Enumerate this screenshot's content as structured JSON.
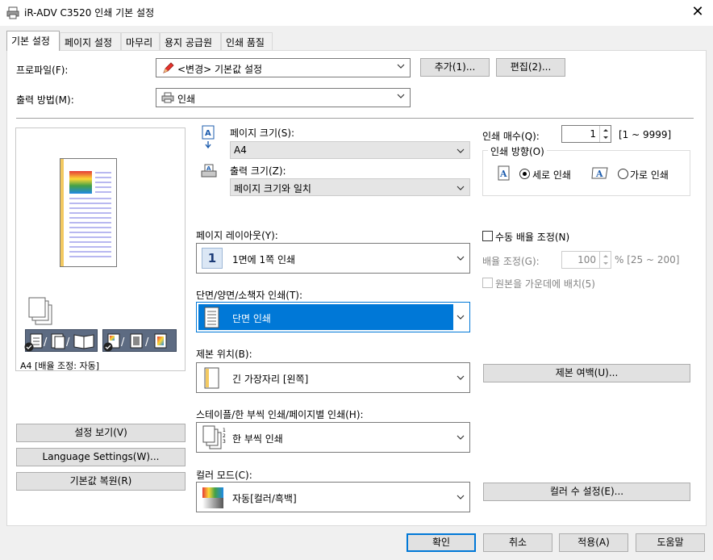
{
  "window": {
    "title": "iR-ADV C3520 인쇄 기본 설정",
    "close_glyph": "✕"
  },
  "tabs": [
    {
      "label": "기본 설정",
      "active": true
    },
    {
      "label": "페이지 설정"
    },
    {
      "label": "마무리"
    },
    {
      "label": "용지 공급원"
    },
    {
      "label": "인쇄 품질"
    }
  ],
  "profile": {
    "label": "프로파일(F):",
    "value": "<변경> 기본값 설정",
    "add_button": "추가(1)...",
    "edit_button": "편집(2)..."
  },
  "output_method": {
    "label": "출력 방법(M):",
    "value": "인쇄"
  },
  "page_size": {
    "label": "페이지 크기(S):",
    "value": "A4"
  },
  "output_size": {
    "label": "출력 크기(Z):",
    "value": "페이지 크기와 일치"
  },
  "copies": {
    "label": "인쇄 매수(Q):",
    "value": "1",
    "range": "[1 ~ 9999]"
  },
  "orientation": {
    "group_label": "인쇄 방향(O)",
    "portrait": "세로 인쇄",
    "landscape": "가로 인쇄",
    "selected": "portrait"
  },
  "page_layout": {
    "label": "페이지 레이아웃(Y):",
    "value": "1면에 1쪽 인쇄",
    "icon_number": "1"
  },
  "manual_scaling": {
    "label": "수동 배율 조정(N)",
    "scale_label": "배율 조정(G):",
    "scale_value": "100",
    "scale_range": "% [25 ~ 200]",
    "center_label": "원본을 가운데에 배치(5)"
  },
  "duplex": {
    "label": "단면/양면/소책자 인쇄(T):",
    "value": "단면 인쇄"
  },
  "binding": {
    "label": "제본 위치(B):",
    "value": "긴 가장자리 [왼쪽]",
    "margin_button": "제본 여백(U)..."
  },
  "staple": {
    "label": "스테이플/한 부씩 인쇄/페이지별 인쇄(H):",
    "value": "한 부씩 인쇄"
  },
  "color_mode": {
    "label": "컬러 모드(C):",
    "value": "자동[컬러/흑백]",
    "settings_button": "컬러 수 설정(E)..."
  },
  "preview": {
    "status": "[배율 조정: 자동]",
    "paper": "A4"
  },
  "left_buttons": {
    "view_settings": "설정 보기(V)",
    "language": "Language Settings(W)...",
    "restore": "기본값 복원(R)"
  },
  "footer": {
    "ok": "확인",
    "cancel": "취소",
    "apply": "적용(A)",
    "help": "도움말"
  },
  "colors": {
    "selection": "#0078d7",
    "button": "#e1e1e1",
    "panel": "#ffffff",
    "background": "#f0f0f0"
  }
}
